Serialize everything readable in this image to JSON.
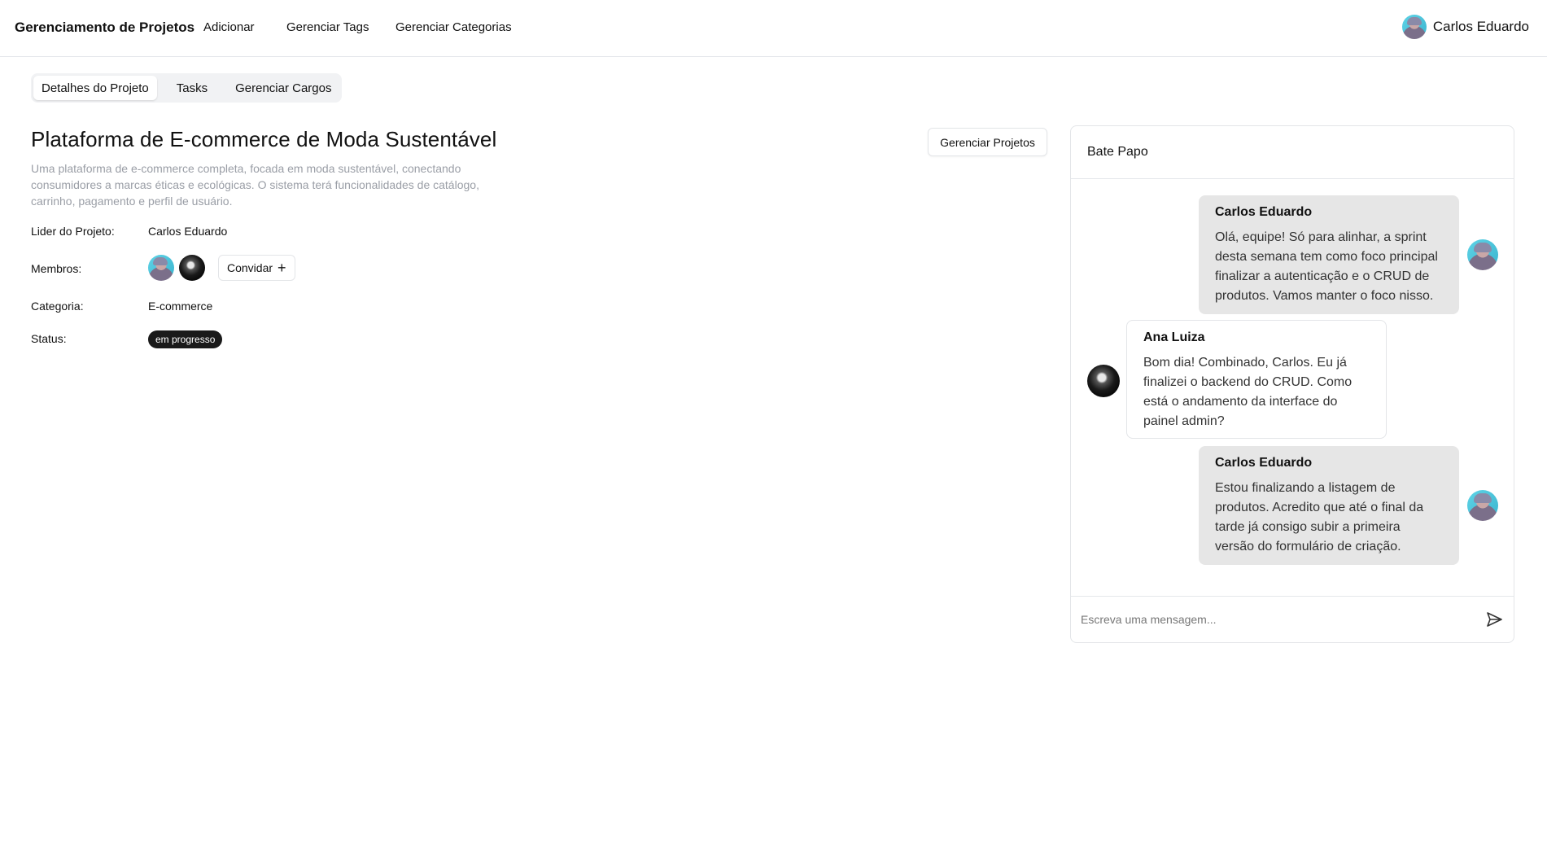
{
  "nav": {
    "brand": "Gerenciamento de Projetos",
    "links": [
      "Adicionar",
      "Gerenciar Tags",
      "Gerenciar Categorias"
    ],
    "user_name": "Carlos Eduardo"
  },
  "tabs": [
    {
      "label": "Detalhes do Projeto",
      "active": true
    },
    {
      "label": "Tasks",
      "active": false
    },
    {
      "label": "Gerenciar Cargos",
      "active": false
    }
  ],
  "project": {
    "title": "Plataforma de E-commerce de Moda Sustentável",
    "description": "Uma plataforma de e-commerce completa, focada em moda sustentável, conectando consumidores a marcas éticas e ecológicas. O sistema terá funcionalidades de catálogo, carrinho, pagamento e perfil de usuário.",
    "manage_button": "Gerenciar Projetos",
    "leader_label": "Lider do Projeto:",
    "leader_value": "Carlos Eduardo",
    "members_label": "Membros:",
    "invite_label": "Convidar",
    "category_label": "Categoria:",
    "category_value": "E-commerce",
    "status_label": "Status:",
    "status_value": "em progresso"
  },
  "chat": {
    "title": "Bate Papo",
    "messages": [
      {
        "author": "Carlos Eduardo",
        "text": "Olá, equipe! Só para alinhar, a sprint desta semana tem como foco principal finalizar a autenticação e o CRUD de produtos. Vamos manter o foco nisso.",
        "mine": true
      },
      {
        "author": "Ana Luiza",
        "text": "Bom dia! Combinado, Carlos. Eu já finalizei o backend do CRUD. Como está o andamento da interface do painel admin?",
        "mine": false
      },
      {
        "author": "Carlos Eduardo",
        "text": "Estou finalizando a listagem de produtos. Acredito que até o final da tarde já consigo subir a primeira versão do formulário de criação.",
        "mine": true
      }
    ],
    "input_placeholder": "Escreva uma mensagem..."
  },
  "icons": {
    "send": "send-icon",
    "plus": "plus-icon"
  }
}
